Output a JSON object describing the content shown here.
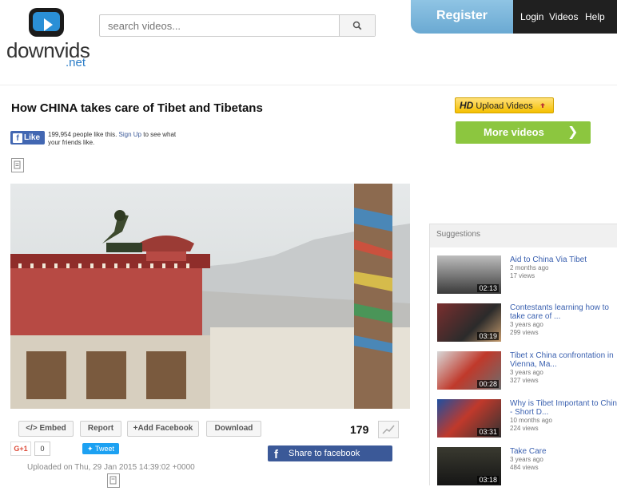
{
  "header": {
    "logo": {
      "brand": "downvids",
      "tld": ".net"
    },
    "search": {
      "placeholder": "search videos..."
    },
    "nav": {
      "register": "Register",
      "login": "Login",
      "videos": "Videos",
      "help": "Help"
    }
  },
  "video": {
    "title": "How CHINA takes care of Tibet and Tibetans",
    "fb_like": {
      "button": "Like",
      "count_text": "199,954 people like this.",
      "signup": "Sign Up",
      "suffix": "to see what your friends like."
    },
    "views": "179",
    "actions": {
      "embed": "</> Embed",
      "report": "Report",
      "add_facebook": "+Add Facebook",
      "download": "Download"
    },
    "social": {
      "gplus": "G+1",
      "gplus_count": "0",
      "tweet": "Tweet",
      "share_facebook": "Share to facebook"
    },
    "uploaded": "Uploaded on Thu, 29 Jan 2015 14:39:02 +0000"
  },
  "sidebar": {
    "hd_upload": {
      "badge": "HD",
      "label": "Upload Videos"
    },
    "more_videos": "More videos",
    "suggestions_heading": "Suggestions",
    "suggestions": [
      {
        "title": "Aid to China Via Tibet",
        "ago": "2 months ago",
        "views": "17 views",
        "duration": "02:13"
      },
      {
        "title": "Contestants learning how to take care of ...",
        "ago": "3 years ago",
        "views": "299 views",
        "duration": "03:19"
      },
      {
        "title": "Tibet x China confrontation in Vienna, Ma...",
        "ago": "3 years ago",
        "views": "327 views",
        "duration": "00:28"
      },
      {
        "title": "Why is Tibet Important to China - Short D...",
        "ago": "10 months ago",
        "views": "224 views",
        "duration": "03:31"
      },
      {
        "title": "Take Care",
        "ago": "3 years ago",
        "views": "484 views",
        "duration": "03:18"
      }
    ]
  },
  "colors": {
    "brand_blue": "#2a8fd6",
    "facebook": "#3b5998",
    "green": "#8cc63f",
    "link": "#3b61b0"
  }
}
